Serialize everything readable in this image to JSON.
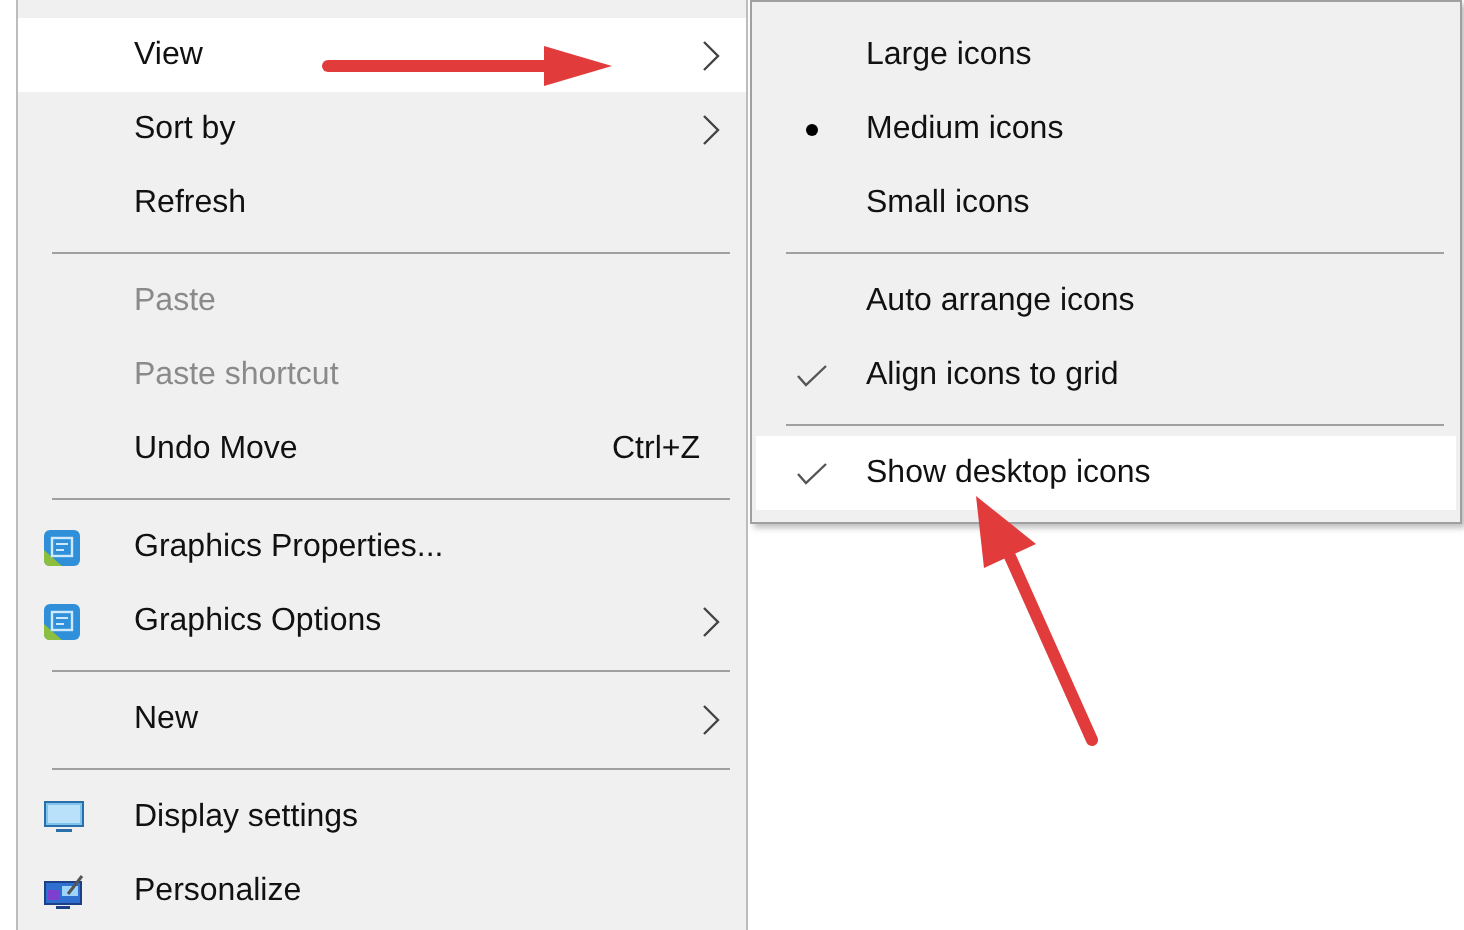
{
  "context_menu": {
    "items": [
      {
        "kind": "plain",
        "label": "View",
        "selected": true,
        "disabled": false,
        "submenu": true
      },
      {
        "kind": "plain",
        "label": "Sort by",
        "selected": false,
        "disabled": false,
        "submenu": true
      },
      {
        "kind": "plain",
        "label": "Refresh",
        "selected": false,
        "disabled": false,
        "submenu": false
      },
      {
        "kind": "separator"
      },
      {
        "kind": "plain",
        "label": "Paste",
        "selected": false,
        "disabled": true,
        "submenu": false
      },
      {
        "kind": "plain",
        "label": "Paste shortcut",
        "selected": false,
        "disabled": true,
        "submenu": false
      },
      {
        "kind": "plain",
        "label": "Undo Move",
        "selected": false,
        "disabled": false,
        "submenu": false,
        "shortcut": "Ctrl+Z"
      },
      {
        "kind": "separator"
      },
      {
        "kind": "graphics",
        "label": "Graphics Properties...",
        "selected": false,
        "disabled": false,
        "submenu": false
      },
      {
        "kind": "graphics",
        "label": "Graphics Options",
        "selected": false,
        "disabled": false,
        "submenu": true
      },
      {
        "kind": "separator"
      },
      {
        "kind": "plain",
        "label": "New",
        "selected": false,
        "disabled": false,
        "submenu": true
      },
      {
        "kind": "separator"
      },
      {
        "kind": "display",
        "label": "Display settings",
        "selected": false,
        "disabled": false,
        "submenu": false
      },
      {
        "kind": "personalize",
        "label": "Personalize",
        "selected": false,
        "disabled": false,
        "submenu": false
      }
    ]
  },
  "view_submenu": {
    "items": [
      {
        "kind": "radio",
        "label": "Large icons",
        "selected": false,
        "checked": false
      },
      {
        "kind": "radio",
        "label": "Medium icons",
        "selected": false,
        "checked": true
      },
      {
        "kind": "radio",
        "label": "Small icons",
        "selected": false,
        "checked": false
      },
      {
        "kind": "separator"
      },
      {
        "kind": "check",
        "label": "Auto arrange icons",
        "selected": false,
        "checked": false
      },
      {
        "kind": "check",
        "label": "Align icons to grid",
        "selected": false,
        "checked": true
      },
      {
        "kind": "separator"
      },
      {
        "kind": "check",
        "label": "Show desktop icons",
        "selected": true,
        "checked": true
      }
    ]
  }
}
